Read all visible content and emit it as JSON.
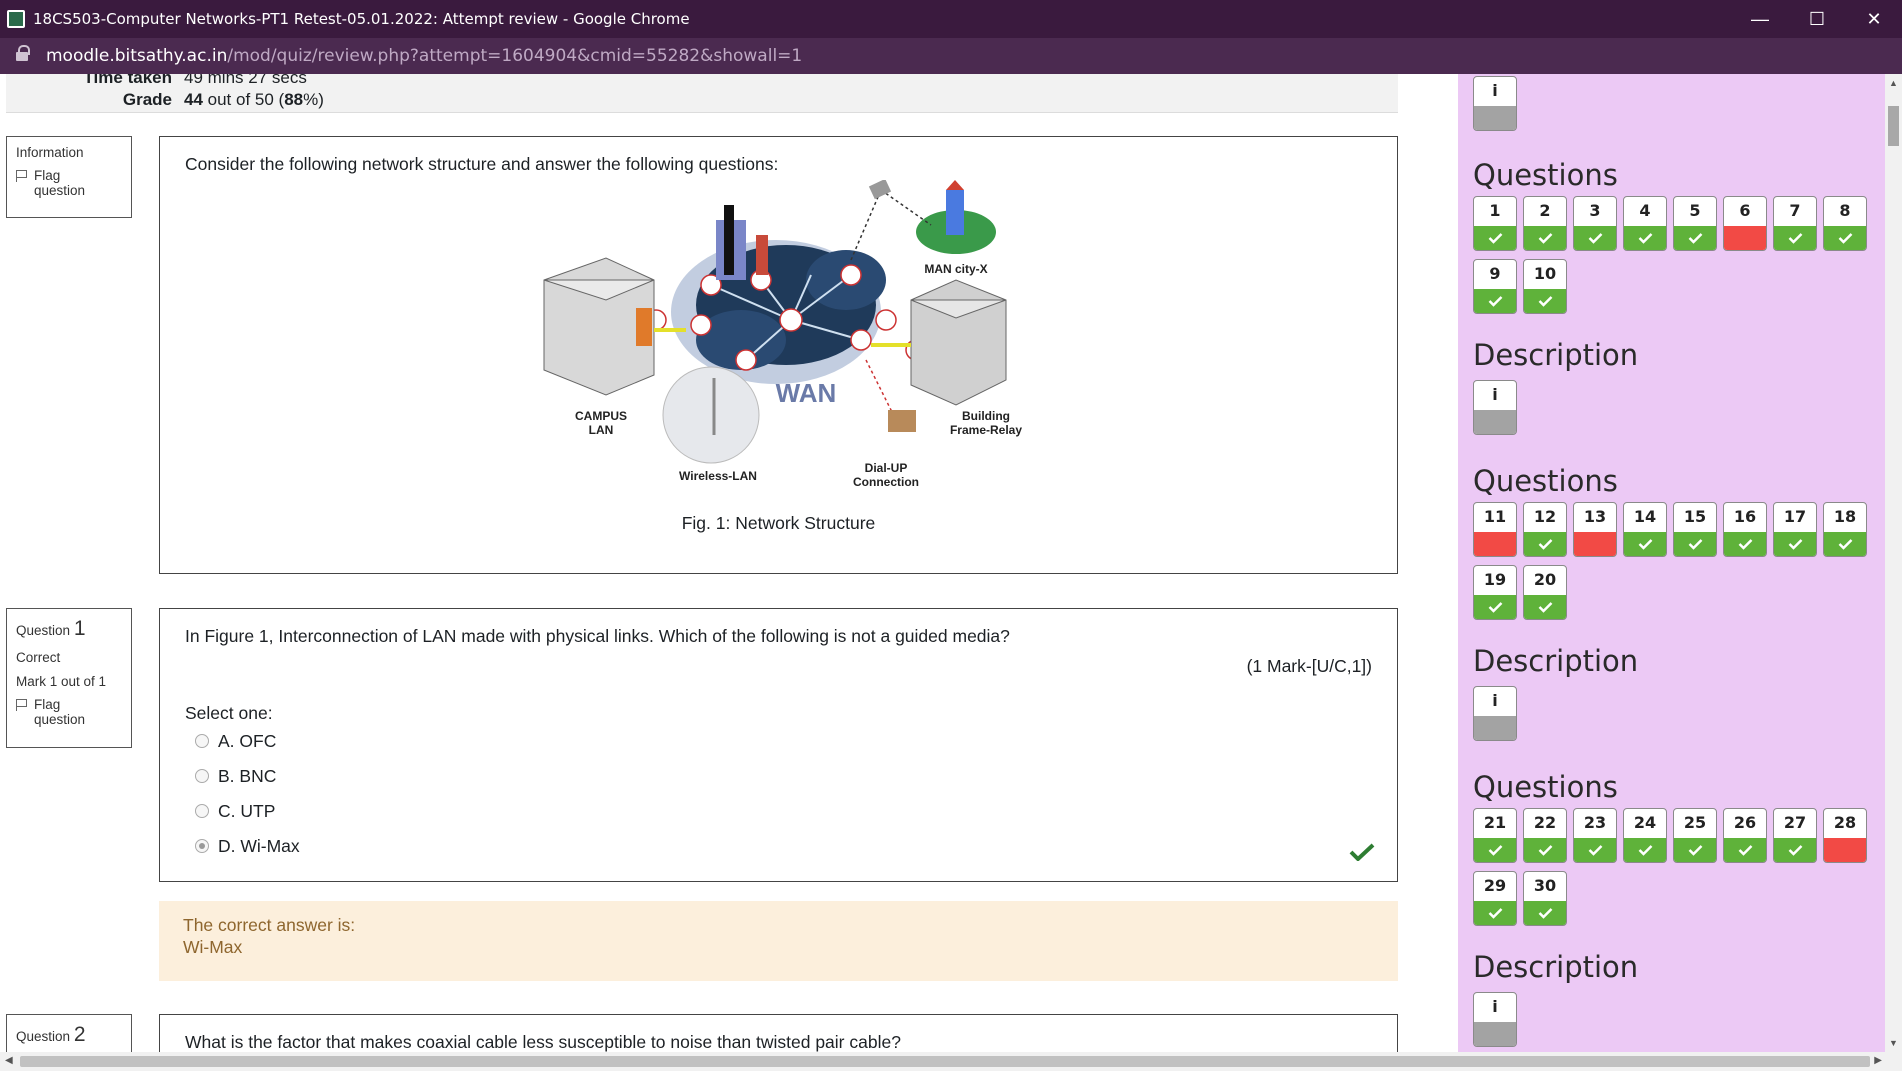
{
  "window": {
    "title": "18CS503-Computer Networks-PT1 Retest-05.01.2022: Attempt review - Google Chrome",
    "minimize": "—",
    "maximize": "☐",
    "close": "✕"
  },
  "address": {
    "host": "moodle.bitsathy.ac.in",
    "path": "/mod/quiz/review.php?attempt=1604904&cmid=55282&showall=1"
  },
  "summary": {
    "time_label": "Time taken",
    "time_value": "49 mins 27 secs",
    "grade_label": "Grade",
    "grade_score": "44",
    "grade_mid": " out of 50 (",
    "grade_pct": "88",
    "grade_end": "%)"
  },
  "info_block": {
    "label": "Information",
    "flag": "Flag question",
    "text": "Consider the following network structure and answer the following questions:",
    "caption": "Fig. 1: Network Structure",
    "figure_labels": {
      "man": "MAN city-X",
      "campus1": "CAMPUS",
      "campus2": "LAN",
      "wan": "WAN",
      "building1": "Building",
      "building2": "Frame-Relay",
      "wireless": "Wireless-LAN",
      "dialup1": "Dial-UP",
      "dialup2": "Connection"
    }
  },
  "q1": {
    "label": "Question",
    "number": "1",
    "status": "Correct",
    "mark": "Mark 1 out of 1",
    "flag": "Flag question",
    "text": "In Figure 1, Interconnection of LAN made with physical links. Which of the following is not a guided media?",
    "marks": "(1 Mark-[U/C,1])",
    "select": "Select one:",
    "options": [
      "A. OFC",
      "B. BNC",
      "C. UTP",
      "D. Wi-Max"
    ],
    "selected_index": 3,
    "feedback_title": "The correct answer is:",
    "feedback_answer": "Wi-Max"
  },
  "q2": {
    "label": "Question",
    "number": "2",
    "text": "What is the factor that makes coaxial cable less susceptible to noise than twisted pair cable?"
  },
  "nav": {
    "info_label": "i",
    "questions_title": "Questions",
    "description_title": "Description",
    "groups": [
      {
        "items": [
          {
            "n": "1",
            "s": "ok"
          },
          {
            "n": "2",
            "s": "ok"
          },
          {
            "n": "3",
            "s": "ok"
          },
          {
            "n": "4",
            "s": "ok"
          },
          {
            "n": "5",
            "s": "ok"
          },
          {
            "n": "6",
            "s": "bad"
          },
          {
            "n": "7",
            "s": "ok"
          },
          {
            "n": "8",
            "s": "ok"
          },
          {
            "n": "9",
            "s": "ok"
          },
          {
            "n": "10",
            "s": "ok"
          }
        ]
      },
      {
        "items": [
          {
            "n": "11",
            "s": "bad"
          },
          {
            "n": "12",
            "s": "ok"
          },
          {
            "n": "13",
            "s": "bad"
          },
          {
            "n": "14",
            "s": "ok"
          },
          {
            "n": "15",
            "s": "ok"
          },
          {
            "n": "16",
            "s": "ok"
          },
          {
            "n": "17",
            "s": "ok"
          },
          {
            "n": "18",
            "s": "ok"
          },
          {
            "n": "19",
            "s": "ok"
          },
          {
            "n": "20",
            "s": "ok"
          }
        ]
      },
      {
        "items": [
          {
            "n": "21",
            "s": "ok"
          },
          {
            "n": "22",
            "s": "ok"
          },
          {
            "n": "23",
            "s": "ok"
          },
          {
            "n": "24",
            "s": "ok"
          },
          {
            "n": "25",
            "s": "ok"
          },
          {
            "n": "26",
            "s": "ok"
          },
          {
            "n": "27",
            "s": "ok"
          },
          {
            "n": "28",
            "s": "bad"
          },
          {
            "n": "29",
            "s": "ok"
          },
          {
            "n": "30",
            "s": "ok"
          }
        ]
      }
    ],
    "colors": {
      "ok": "#5fb23a",
      "bad": "#f24a45",
      "info": "#a3a3a3"
    }
  }
}
